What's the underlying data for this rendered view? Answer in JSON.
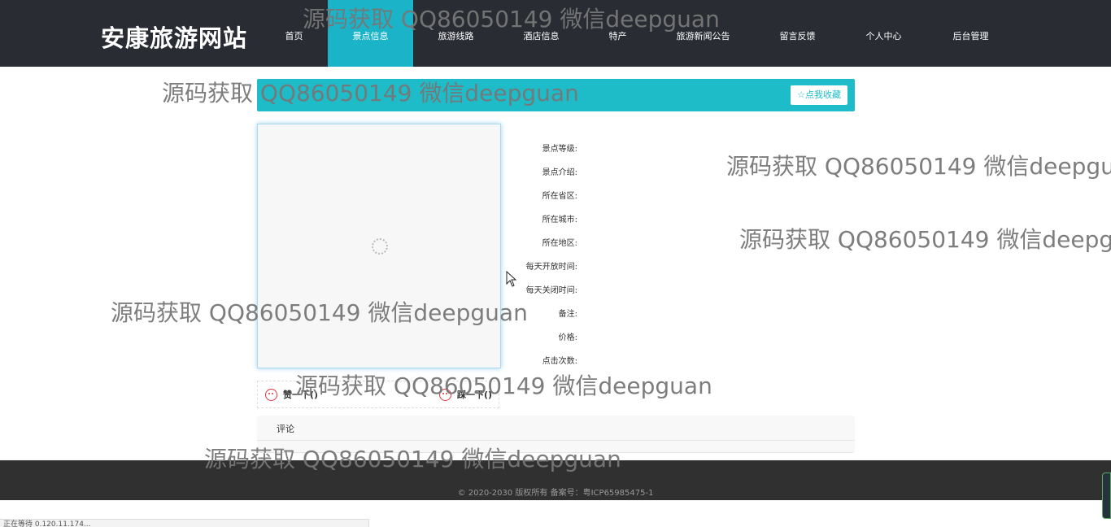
{
  "header": {
    "logo": "安康旅游网站",
    "nav": [
      {
        "label": "首页"
      },
      {
        "label": "景点信息",
        "active": true
      },
      {
        "label": "旅游线路"
      },
      {
        "label": "酒店信息"
      },
      {
        "label": "特产"
      },
      {
        "label": "旅游新闻公告"
      },
      {
        "label": "留言反馈"
      },
      {
        "label": "个人中心"
      },
      {
        "label": "后台管理"
      }
    ]
  },
  "watermark": "源码获取 QQ86050149 微信deepguan",
  "main": {
    "favorite_button": "☆点我收藏",
    "fields": [
      "景点等级:",
      "景点介绍:",
      "所在省区:",
      "所在城市:",
      "所在地区:",
      "每天开放时间:",
      "每天关闭时间:",
      "备注:",
      "价格:",
      "点击次数:"
    ],
    "like_label": "赞一下()",
    "dislike_label": "踩一下()",
    "comment_title": "评论"
  },
  "footer": {
    "text": "© 2020-2030 版权所有 备案号：粤ICP65985475-1"
  },
  "status_bar": "正在等待 0.120.11.174..."
}
